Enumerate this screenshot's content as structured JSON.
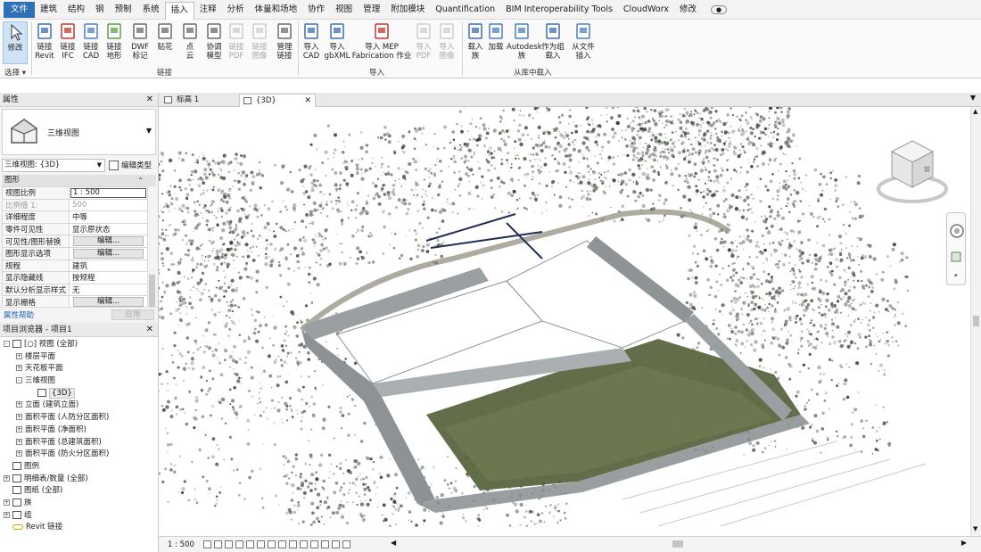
{
  "menubar": {
    "tabs": [
      "文件",
      "建筑",
      "结构",
      "钢",
      "预制",
      "系统",
      "插入",
      "注释",
      "分析",
      "体量和场地",
      "协作",
      "视图",
      "管理",
      "附加模块",
      "Quantification",
      "BIM Interoperability Tools",
      "CloudWorx",
      "修改"
    ],
    "active_tab": "插入"
  },
  "ribbon": {
    "buttons": [
      {
        "l1": "修改",
        "l2": "",
        "icon": "cursor-icon"
      },
      {
        "l1": "链接",
        "l2": "Revit",
        "icon": "revit-link-icon"
      },
      {
        "l1": "链接",
        "l2": "IFC",
        "icon": "ifc-link-icon"
      },
      {
        "l1": "链接",
        "l2": "CAD",
        "icon": "cad-link-icon"
      },
      {
        "l1": "链接",
        "l2": "地形",
        "icon": "topo-link-icon"
      },
      {
        "l1": "DWF",
        "l2": "标记",
        "icon": "dwf-icon"
      },
      {
        "l1": "贴花",
        "l2": "",
        "icon": "decal-icon"
      },
      {
        "l1": "点",
        "l2": "云",
        "icon": "point-cloud-icon"
      },
      {
        "l1": "协调",
        "l2": "模型",
        "icon": "coordination-model-icon"
      },
      {
        "l1": "链接",
        "l2": "PDF",
        "icon": "pdf-link-icon"
      },
      {
        "l1": "链接",
        "l2": "图像",
        "icon": "image-link-icon"
      },
      {
        "l1": "管理",
        "l2": "链接",
        "icon": "manage-links-icon"
      },
      {
        "l1": "导入",
        "l2": "CAD",
        "icon": "import-cad-icon"
      },
      {
        "l1": "导入",
        "l2": "gbXML",
        "icon": "import-gbxml-icon"
      },
      {
        "l1": "导入 MEP",
        "l2": "Fabrication 作业",
        "icon": "mep-fabrication-icon"
      },
      {
        "l1": "导入",
        "l2": "PDF",
        "icon": "import-pdf-icon"
      },
      {
        "l1": "导入",
        "l2": "图像",
        "icon": "import-image-icon"
      },
      {
        "l1": "载入",
        "l2": "族",
        "icon": "load-family-icon"
      },
      {
        "l1": "加载",
        "l2": "",
        "icon": "load-autodesk-icon"
      },
      {
        "l1": "Autodesk",
        "l2": "族",
        "icon": "autodesk-family-icon"
      },
      {
        "l1": "作为组",
        "l2": "载入",
        "icon": "load-as-group-icon"
      },
      {
        "l1": "从文件",
        "l2": "插入",
        "icon": "insert-from-file-icon"
      }
    ],
    "groups": [
      "选择 ▾",
      "链接",
      "导入",
      "从库中载入"
    ]
  },
  "properties": {
    "title": "属性",
    "type_name": "三维视图",
    "view_selector": "三维视图: {3D}",
    "edit_type": "编辑类型",
    "section": "图形",
    "rows": [
      {
        "k": "视图比例",
        "v": "1 : 500"
      },
      {
        "k": "比例值 1:",
        "v": "500"
      },
      {
        "k": "详细程度",
        "v": "中等"
      },
      {
        "k": "零件可见性",
        "v": "显示原状态"
      },
      {
        "k": "可见性/图形替换",
        "v": "编辑..."
      },
      {
        "k": "图形显示选项",
        "v": "编辑..."
      },
      {
        "k": "规程",
        "v": "建筑"
      },
      {
        "k": "显示隐藏线",
        "v": "按规程"
      },
      {
        "k": "默认分析显示样式",
        "v": "无"
      },
      {
        "k": "显示栅格",
        "v": "编辑..."
      }
    ],
    "help_link": "属性帮助",
    "apply": "应用"
  },
  "browser": {
    "title": "项目浏览器 - 项目1",
    "items": [
      {
        "label": "[○] 视图 (全部)",
        "indent": 0,
        "exp": "-"
      },
      {
        "label": "楼层平面",
        "indent": 1,
        "exp": "+"
      },
      {
        "label": "天花板平面",
        "indent": 1,
        "exp": "+"
      },
      {
        "label": "三维视图",
        "indent": 1,
        "exp": "-"
      },
      {
        "label": "{3D}",
        "indent": 2,
        "exp": ""
      },
      {
        "label": "立面 (建筑立面)",
        "indent": 1,
        "exp": "+"
      },
      {
        "label": "面积平面 (人防分区面积)",
        "indent": 1,
        "exp": "+"
      },
      {
        "label": "面积平面 (净面积)",
        "indent": 1,
        "exp": "+"
      },
      {
        "label": "面积平面 (总建筑面积)",
        "indent": 1,
        "exp": "+"
      },
      {
        "label": "面积平面 (防火分区面积)",
        "indent": 1,
        "exp": "+"
      },
      {
        "label": "图例",
        "indent": 0,
        "exp": ""
      },
      {
        "label": "明细表/数量 (全部)",
        "indent": 0,
        "exp": "+"
      },
      {
        "label": "图纸 (全部)",
        "indent": 0,
        "exp": ""
      },
      {
        "label": "族",
        "indent": 0,
        "exp": "+"
      },
      {
        "label": "组",
        "indent": 0,
        "exp": "+"
      },
      {
        "label": "Revit 链接",
        "indent": 0,
        "exp": ""
      }
    ]
  },
  "view_tabs": [
    {
      "label": "标高 1",
      "active": false
    },
    {
      "label": "{3D}",
      "active": true
    }
  ],
  "viewcube": {
    "face_label": "前"
  },
  "statusbar": {
    "scale": "1 : 500"
  },
  "colors": {
    "accent": "#2f6fb6",
    "ribbon_bg": "#fafafa",
    "selected_btn": "#cfe3f7"
  }
}
